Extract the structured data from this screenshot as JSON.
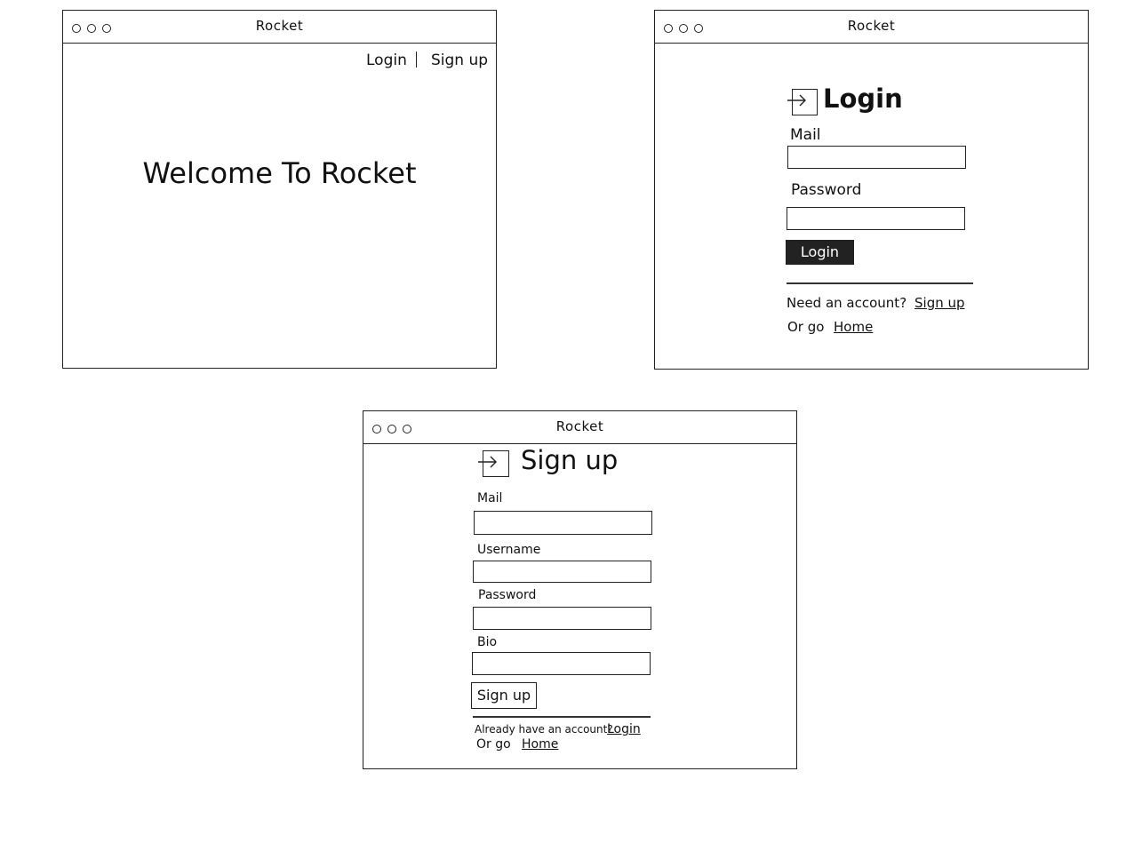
{
  "app_title": "Rocket",
  "home": {
    "nav_login": "Login",
    "nav_signup": "Sign up",
    "welcome": "Welcome To Rocket"
  },
  "login": {
    "heading": "Login",
    "mail_label": "Mail",
    "password_label": "Password",
    "button": "Login",
    "need_account": "Need an account?",
    "signup_link": "Sign up",
    "or_go": "Or go",
    "home_link": "Home"
  },
  "signup": {
    "heading": "Sign up",
    "mail_label": "Mail",
    "username_label": "Username",
    "password_label": "Password",
    "bio_label": "Bio",
    "button": "Sign up",
    "have_account": "Already have an account?",
    "login_link": "Login",
    "or_go": "Or go",
    "home_link": "Home"
  },
  "colors": {
    "ink": "#222222",
    "button_dark": "#222222",
    "background": "#ffffff"
  },
  "icons": [
    "login-icon"
  ]
}
